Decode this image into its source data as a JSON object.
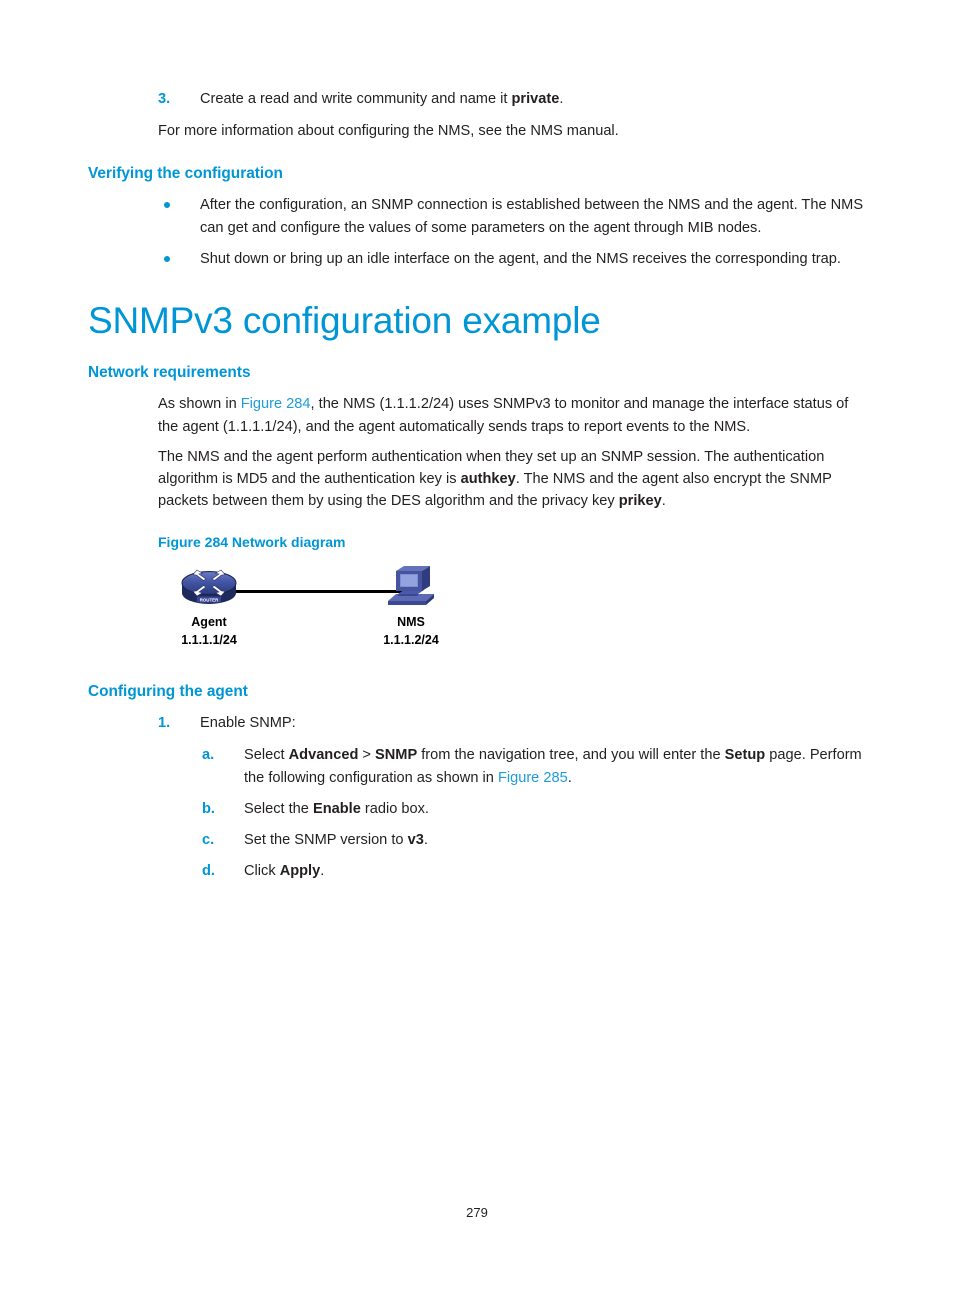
{
  "document": {
    "page_number": "279"
  },
  "step3": {
    "marker": "3.",
    "text_before": "Create a read and write community and name it ",
    "bold": "private",
    "text_after": "."
  },
  "nms_note": "For more information about configuring the NMS, see the NMS manual.",
  "verifying": {
    "heading": "Verifying the configuration",
    "bullets": [
      "After the configuration, an SNMP connection is established between the NMS and the agent. The NMS can get and configure the values of some parameters on the agent through MIB nodes.",
      "Shut down or bring up an idle interface on the agent, and the NMS receives the corresponding trap."
    ]
  },
  "main_heading": "SNMPv3 configuration example",
  "network_requirements": {
    "heading": "Network requirements",
    "para1": {
      "a": "As shown in ",
      "xref": "Figure 284",
      "b": ", the NMS (1.1.1.2/24) uses SNMPv3 to monitor and manage the interface status of the agent (1.1.1.1/24), and the agent automatically sends traps to report events to the NMS."
    },
    "para2": {
      "a": "The NMS and the agent perform authentication when they set up an SNMP session. The authentication algorithm is MD5 and the authentication key is ",
      "bold1": "authkey",
      "b": ". The NMS and the agent also encrypt the SNMP packets between them by using the DES algorithm and the privacy key ",
      "bold2": "prikey",
      "c": "."
    }
  },
  "figure": {
    "caption": "Figure 284 Network diagram",
    "nodes": [
      {
        "label": "Agent",
        "address": "1.1.1.1/24",
        "icon": "router-icon"
      },
      {
        "label": "NMS",
        "address": "1.1.1.2/24",
        "icon": "workstation-icon"
      }
    ],
    "router_badge": "ROUTER"
  },
  "configuring_agent": {
    "heading": "Configuring the agent",
    "step1": {
      "marker": "1.",
      "text": "Enable SNMP:"
    },
    "substeps": [
      {
        "marker": "a.",
        "p1": "Select ",
        "b1": "Advanced",
        "p2": " > ",
        "b2": "SNMP",
        "p3": " from the navigation tree, and you will enter the ",
        "b3": "Setup",
        "p4": " page. Perform the following configuration as shown in ",
        "xref": "Figure 285",
        "p5": "."
      },
      {
        "marker": "b.",
        "p1": "Select the ",
        "b1": "Enable",
        "p2": " radio box."
      },
      {
        "marker": "c.",
        "p1": "Set the SNMP version to ",
        "b1": "v3",
        "p2": "."
      },
      {
        "marker": "d.",
        "p1": "Click ",
        "b1": "Apply",
        "p2": "."
      }
    ]
  },
  "colors": {
    "accent_blue": "#0096d6",
    "xref_blue": "#1f9cd8",
    "body_text": "#231f20",
    "icon_navy": "#2b3a7a",
    "icon_blue": "#4a5bab"
  }
}
